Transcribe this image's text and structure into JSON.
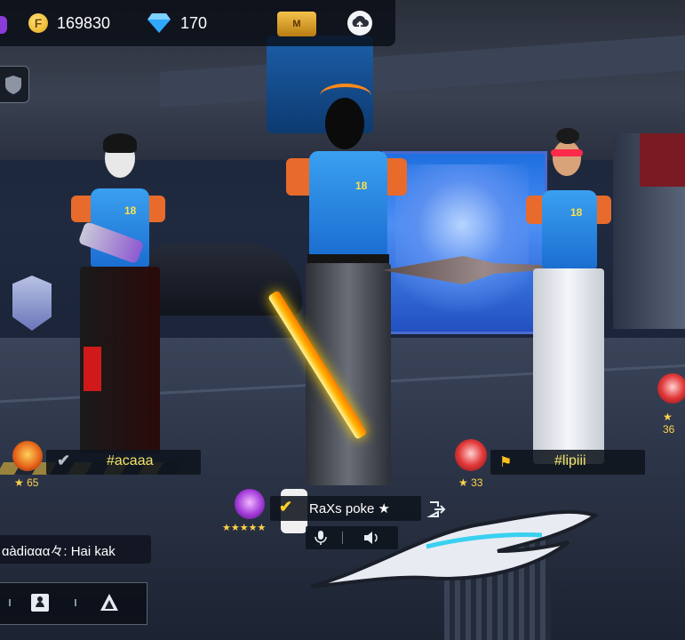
{
  "currency": {
    "gold_icon": "F",
    "gold": "169830",
    "diamonds": "170"
  },
  "topbar": {
    "membership_label": "M",
    "cloud_icon": "cloud-upload-icon"
  },
  "players": [
    {
      "name": "#acaaa",
      "level": "65",
      "status_icon": "check-icon"
    },
    {
      "name": "RaXs poke ★",
      "stars": "★★★★★",
      "status_icon": "check-icon"
    },
    {
      "name": "#lipiii",
      "level": "33",
      "status_icon": "flag-icon"
    }
  ],
  "offscreen_level": "36",
  "chat": {
    "message": "ɑàdiααα々: Hai kak"
  },
  "colors": {
    "gold": "#f2e36a",
    "accent_blue": "#1a6dd0",
    "fire": "#e6661a"
  }
}
